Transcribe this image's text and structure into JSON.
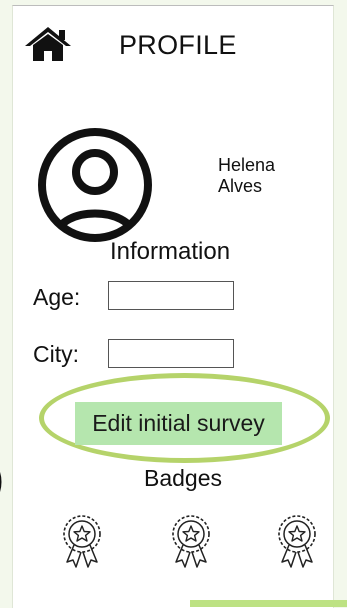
{
  "header": {
    "title": "PROFILE",
    "home_icon": "home-icon"
  },
  "user": {
    "first_name": "Helena",
    "last_name": "Alves",
    "avatar_icon": "user-avatar-icon"
  },
  "information": {
    "title": "Information",
    "age_label": "Age:",
    "age_value": "",
    "city_label": "City:",
    "city_value": ""
  },
  "actions": {
    "edit_survey_label": "Edit initial survey",
    "highlight_color": "#b5d36a",
    "button_color": "#b5e6ae"
  },
  "badges": {
    "title": "Badges",
    "items": [
      "award-badge-icon",
      "award-badge-icon",
      "award-badge-icon"
    ]
  }
}
